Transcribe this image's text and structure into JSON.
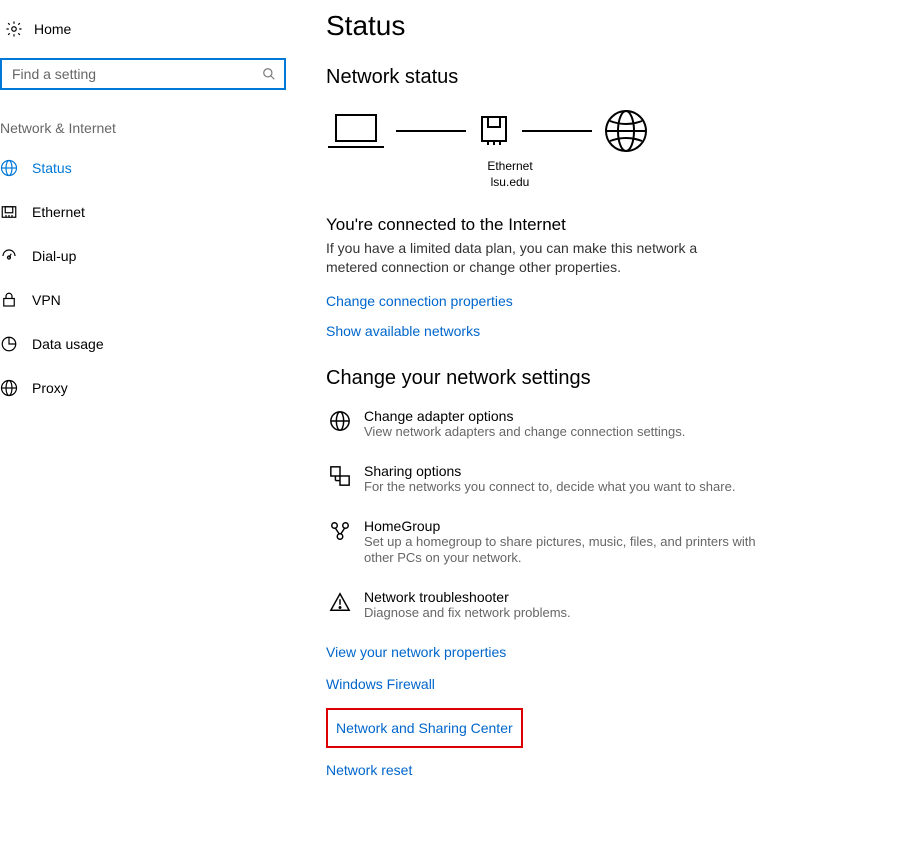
{
  "sidebar": {
    "home_label": "Home",
    "search_placeholder": "Find a setting",
    "group_header": "Network & Internet",
    "items": [
      {
        "label": "Status",
        "active": true
      },
      {
        "label": "Ethernet",
        "active": false
      },
      {
        "label": "Dial-up",
        "active": false
      },
      {
        "label": "VPN",
        "active": false
      },
      {
        "label": "Data usage",
        "active": false
      },
      {
        "label": "Proxy",
        "active": false
      }
    ]
  },
  "main": {
    "page_title": "Status",
    "network_status_header": "Network status",
    "ethernet_caption_line1": "Ethernet",
    "ethernet_caption_line2": "lsu.edu",
    "connected_title": "You're connected to the Internet",
    "connected_body": "If you have a limited data plan, you can make this network a metered connection or change other properties.",
    "change_conn_link": "Change connection properties",
    "show_networks_link": "Show available networks",
    "change_settings_header": "Change your network settings",
    "options": [
      {
        "title": "Change adapter options",
        "desc": "View network adapters and change connection settings."
      },
      {
        "title": "Sharing options",
        "desc": "For the networks you connect to, decide what you want to share."
      },
      {
        "title": "HomeGroup",
        "desc": "Set up a homegroup to share pictures, music, files, and printers with other PCs on your network."
      },
      {
        "title": "Network troubleshooter",
        "desc": "Diagnose and fix network problems."
      }
    ],
    "bottom_links": {
      "view_props": "View your network properties",
      "firewall": "Windows Firewall",
      "sharing_center": "Network and Sharing Center",
      "reset": "Network reset"
    }
  }
}
